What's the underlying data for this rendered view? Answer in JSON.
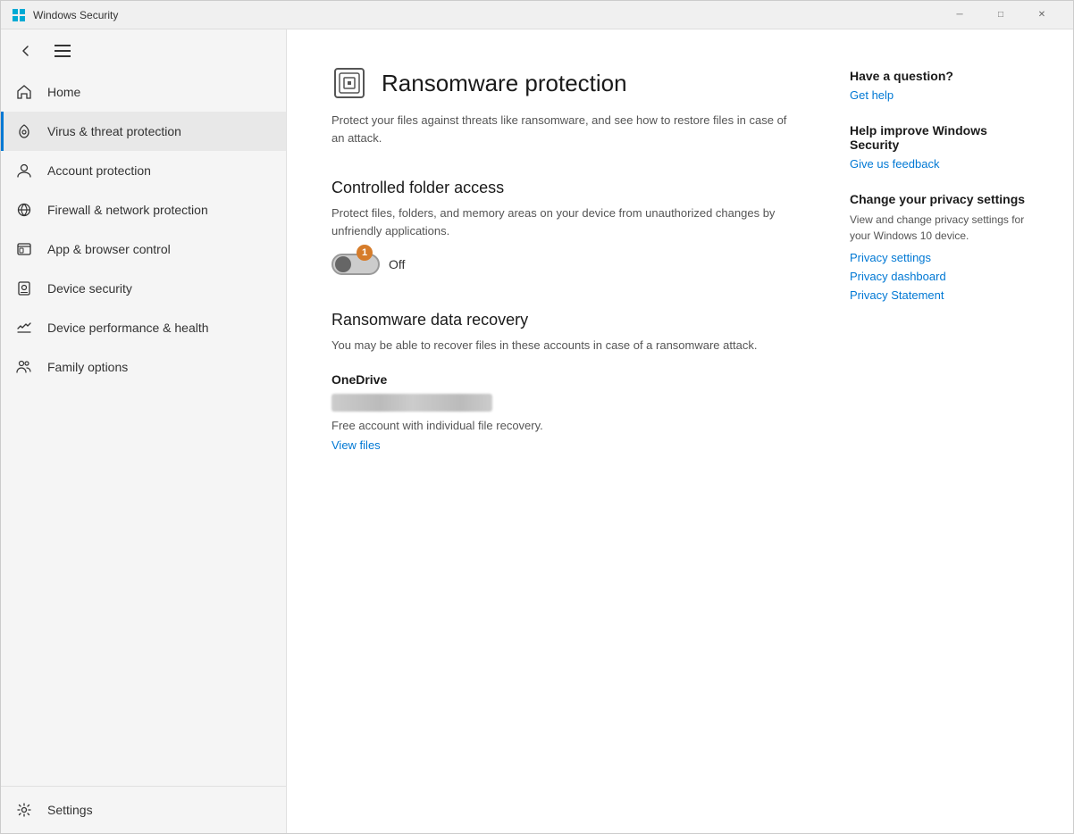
{
  "window": {
    "title": "Windows Security",
    "controls": {
      "minimize": "─",
      "maximize": "□",
      "close": "✕"
    }
  },
  "sidebar": {
    "nav_items": [
      {
        "id": "home",
        "label": "Home",
        "active": false
      },
      {
        "id": "virus",
        "label": "Virus & threat protection",
        "active": true
      },
      {
        "id": "account",
        "label": "Account protection",
        "active": false
      },
      {
        "id": "firewall",
        "label": "Firewall & network protection",
        "active": false
      },
      {
        "id": "app-browser",
        "label": "App & browser control",
        "active": false
      },
      {
        "id": "device-security",
        "label": "Device security",
        "active": false
      },
      {
        "id": "device-health",
        "label": "Device performance & health",
        "active": false
      },
      {
        "id": "family",
        "label": "Family options",
        "active": false
      }
    ],
    "settings_label": "Settings"
  },
  "page": {
    "title": "Ransomware protection",
    "subtitle": "Protect your files against threats like ransomware, and see how to restore files in case of an attack.",
    "controlled_folder": {
      "title": "Controlled folder access",
      "description": "Protect files, folders, and memory areas on your device from unauthorized changes by unfriendly applications.",
      "toggle_state": "Off",
      "badge": "1"
    },
    "data_recovery": {
      "title": "Ransomware data recovery",
      "description": "You may be able to recover files in these accounts in case of a ransomware attack.",
      "onedrive_label": "OneDrive",
      "onedrive_info": "Free account with individual file recovery.",
      "view_files_link": "View files"
    }
  },
  "right_panel": {
    "help_title": "Have a question?",
    "get_help_link": "Get help",
    "improve_title": "Help improve Windows Security",
    "feedback_link": "Give us feedback",
    "privacy_title": "Change your privacy settings",
    "privacy_desc": "View and change privacy settings for your Windows 10 device.",
    "privacy_settings_link": "Privacy settings",
    "privacy_dashboard_link": "Privacy dashboard",
    "privacy_statement_link": "Privacy Statement"
  }
}
